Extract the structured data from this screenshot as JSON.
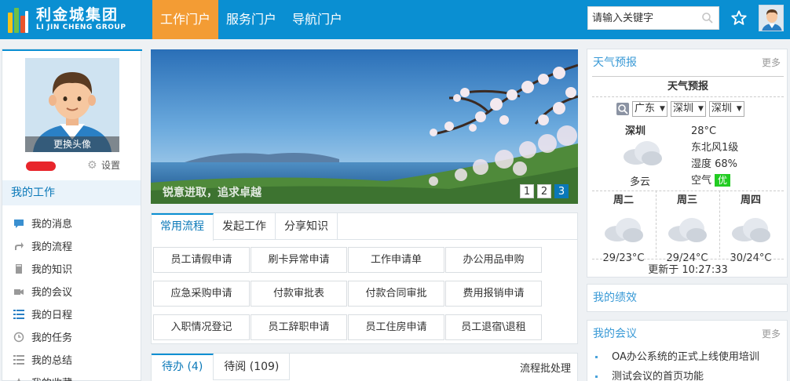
{
  "brand": {
    "name_cn": "利金城集团",
    "name_en": "LI JIN CHENG GROUP"
  },
  "nav": {
    "items": [
      {
        "label": "工作门户"
      },
      {
        "label": "服务门户"
      },
      {
        "label": "导航门户"
      }
    ],
    "active": 0
  },
  "search": {
    "placeholder": "请输入关键字"
  },
  "profile": {
    "change_avatar": "更换头像",
    "settings": "设置"
  },
  "my_work": {
    "title": "我的工作",
    "items": [
      {
        "label": "我的消息",
        "icon": "message-icon"
      },
      {
        "label": "我的流程",
        "icon": "share-icon"
      },
      {
        "label": "我的知识",
        "icon": "book-icon"
      },
      {
        "label": "我的会议",
        "icon": "video-icon"
      },
      {
        "label": "我的日程",
        "icon": "list-icon"
      },
      {
        "label": "我的任务",
        "icon": "clock-icon"
      },
      {
        "label": "我的总结",
        "icon": "list-icon"
      },
      {
        "label": "我的收藏",
        "icon": "star-icon"
      }
    ]
  },
  "banner": {
    "caption": "锐意进取，追求卓越",
    "pages": [
      "1",
      "2",
      "3"
    ],
    "active_page": 2
  },
  "flows": {
    "tabs": [
      "常用流程",
      "发起工作",
      "分享知识"
    ],
    "active_tab": 0,
    "buttons": [
      "员工请假申请",
      "刷卡异常申请",
      "工作申请单",
      "办公用品申购",
      "应急采购申请",
      "付款审批表",
      "付款合同审批",
      "费用报销申请",
      "入职情况登记",
      "员工辞职申请",
      "员工住房申请",
      "员工退宿\\退租"
    ]
  },
  "todo": {
    "tabs": [
      "待办 (4)",
      "待阅 (109)"
    ],
    "active_tab": 0,
    "link": "流程批处理"
  },
  "weather_panel": {
    "title": "天气预报",
    "more": "更多",
    "widget_title": "天气预报",
    "selects": [
      "广东",
      "深圳",
      "深圳"
    ],
    "city": "深圳",
    "desc": "多云",
    "temp": "28°C",
    "wind": "东北风1级",
    "humidity": "湿度  68%",
    "air_label": "空气",
    "air_quality": "优",
    "forecast": [
      {
        "day": "周二",
        "temp": "29/23°C"
      },
      {
        "day": "周三",
        "temp": "29/24°C"
      },
      {
        "day": "周四",
        "temp": "30/24°C"
      }
    ],
    "updated": "更新于  10:27:33"
  },
  "performance_panel": {
    "title": "我的绩效"
  },
  "meeting_panel": {
    "title": "我的会议",
    "more": "更多",
    "items": [
      "OA办公系统的正式上线使用培训",
      "测试会议的首页功能"
    ]
  },
  "colors": {
    "primary": "#0a8fd2",
    "nav_active": "#f39c34",
    "accent_red": "#e8252b",
    "air_good": "#22cc22"
  }
}
